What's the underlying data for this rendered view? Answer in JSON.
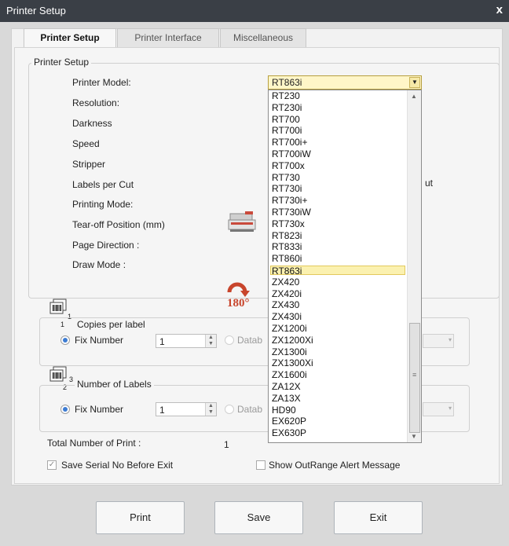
{
  "window": {
    "title": "Printer Setup",
    "close_glyph": "x"
  },
  "tabs": [
    {
      "label": "Printer Setup",
      "active": true
    },
    {
      "label": "Printer Interface",
      "active": false
    },
    {
      "label": "Miscellaneous",
      "active": false
    }
  ],
  "printer_setup": {
    "group_label": "Printer Setup",
    "fields": [
      {
        "label": "Printer Model:"
      },
      {
        "label": "Resolution:"
      },
      {
        "label": "Darkness"
      },
      {
        "label": "Speed"
      },
      {
        "label": "Stripper"
      },
      {
        "label": "Labels per Cut"
      },
      {
        "label": "Printing Mode:"
      },
      {
        "label": "Tear-off Position  (mm)"
      },
      {
        "label": "Page Direction :"
      },
      {
        "label": "Draw Mode :"
      }
    ],
    "partial_right_text": "ut"
  },
  "model_combo": {
    "selected": "RT863i",
    "options": [
      "RT230",
      "RT230i",
      "RT700",
      "RT700i",
      "RT700i+",
      "RT700iW",
      "RT700x",
      "RT730",
      "RT730i",
      "RT730i+",
      "RT730iW",
      "RT730x",
      "RT823i",
      "RT833i",
      "RT860i",
      "RT863i",
      "ZX420",
      "ZX420i",
      "ZX430",
      "ZX430i",
      "ZX1200i",
      "ZX1200Xi",
      "ZX1300i",
      "ZX1300Xi",
      "ZX1600i",
      "ZA12X",
      "ZA13X",
      "HD90",
      "EX620P",
      "EX630P"
    ]
  },
  "icons": {
    "printer": "printer-icon",
    "rotate": "rotate-180-icon",
    "rotate_label": "180°",
    "copies": "copies-per-label-icon",
    "copies_super": "1",
    "copies_sub": "1",
    "labels": "number-of-labels-icon",
    "labels_super": "3",
    "labels_sub": "2"
  },
  "copies_per_label": {
    "group_label": "Copies per label",
    "fix_number_label": "Fix Number",
    "fix_number_value": "1",
    "database_label": "Datab"
  },
  "number_of_labels": {
    "group_label": "Number of Labels",
    "fix_number_label": "Fix Number",
    "fix_number_value": "1",
    "database_label": "Datab"
  },
  "total": {
    "label": "Total Number of Print :",
    "value": "1"
  },
  "options": {
    "save_serial": {
      "label": "Save Serial No Before Exit",
      "checked": true
    },
    "show_outrange": {
      "label": "Show OutRange Alert Message",
      "checked": false
    }
  },
  "buttons": {
    "print": "Print",
    "save": "Save",
    "exit": "Exit"
  },
  "colors": {
    "titlebar": "#3a3f46",
    "selection_bg": "#fbf1b0",
    "combo_bg": "#fff6c8",
    "rotate_icon": "#c8452c",
    "radio_on": "#3d7cd3"
  }
}
